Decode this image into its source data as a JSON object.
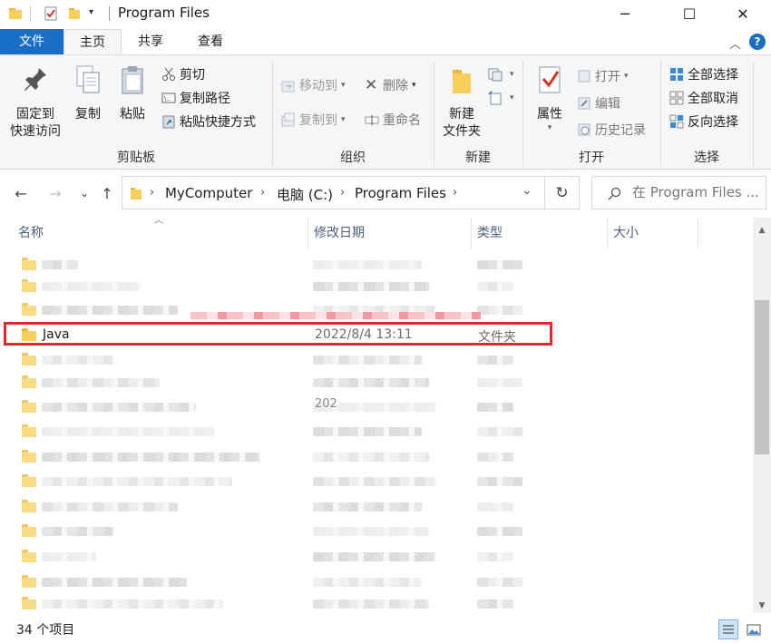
{
  "window": {
    "title": "Program Files",
    "minimize": "─",
    "maximize": "☐",
    "close": "✕"
  },
  "ribbon_tabs": {
    "file": "文件",
    "home": "主页",
    "share": "共享",
    "view": "查看",
    "collapse": "^",
    "help": "?"
  },
  "clipboard": {
    "label": "剪贴板",
    "pin_line1": "固定到",
    "pin_line2": "快速访问",
    "copy": "复制",
    "paste": "粘贴",
    "cut": "剪切",
    "copy_path": "复制路径",
    "paste_shortcut": "粘贴快捷方式"
  },
  "organize": {
    "label": "组织",
    "move_to": "移动到",
    "copy_to": "复制到",
    "delete": "删除",
    "rename": "重命名"
  },
  "new_group": {
    "label": "新建",
    "new_folder_line1": "新建",
    "new_folder_line2": "文件夹"
  },
  "open_group": {
    "label": "打开",
    "properties": "属性",
    "open": "打开",
    "edit": "编辑",
    "history": "历史记录"
  },
  "select_group": {
    "label": "选择",
    "select_all": "全部选择",
    "select_none": "全部取消",
    "invert": "反向选择"
  },
  "address": {
    "crumbs": [
      "MyComputer",
      "电脑 (C:)",
      "Program Files"
    ],
    "search_placeholder": "在 Program Files ..."
  },
  "columns": {
    "name": "名称",
    "date": "修改日期",
    "type": "类型",
    "size": "大小"
  },
  "files": {
    "highlighted": {
      "name": "Java",
      "date": "2022/8/4 13:11",
      "type": "文件夹"
    },
    "partial_date": "202"
  },
  "status": {
    "item_count": "34 个项目"
  },
  "colors": {
    "file_tab": "#1a6fc4",
    "folder": "#f8cf5b",
    "highlight_border": "#e0282f",
    "header_text": "#4c607a"
  }
}
